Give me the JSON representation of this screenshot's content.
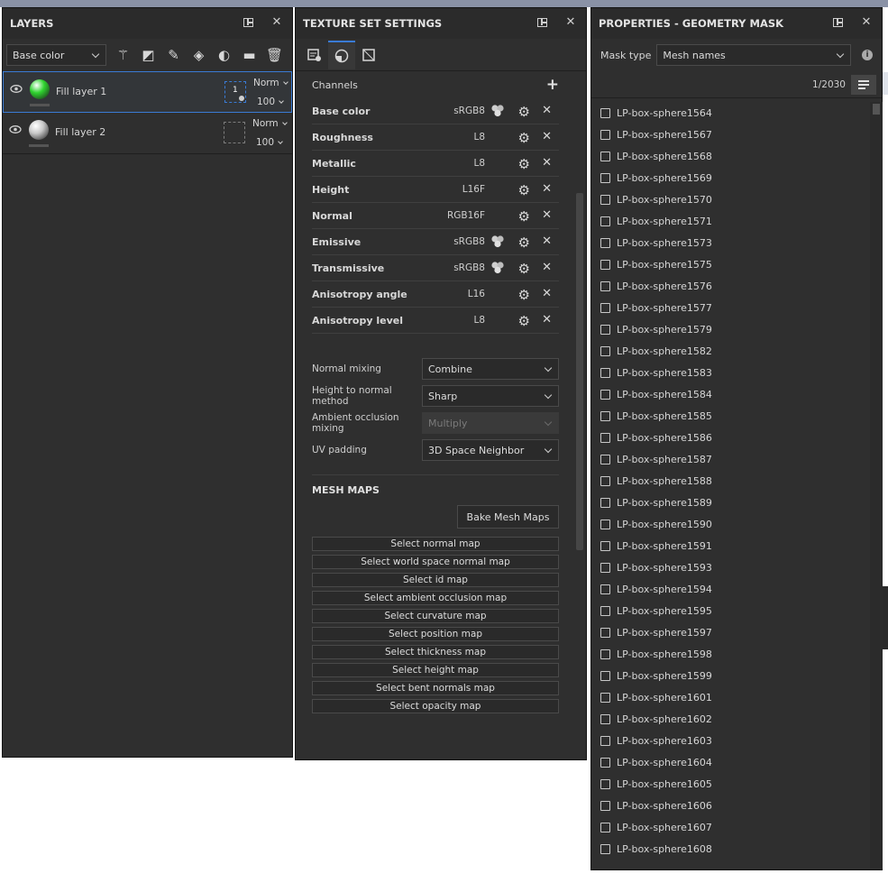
{
  "layers_panel": {
    "title": "LAYERS",
    "channel_select": "Base color",
    "tool_icons": [
      "magic-wand-icon",
      "add-layer-icon",
      "paint-layer-icon",
      "fill-layer-icon",
      "add-mask-icon",
      "folder-icon",
      "delete-icon"
    ],
    "layers": [
      {
        "name": "Fill layer 1",
        "blend": "Norm",
        "opacity": "100",
        "mask_label": "1",
        "selected": true,
        "ball_color": "#2fd42f"
      },
      {
        "name": "Fill layer 2",
        "blend": "Norm",
        "opacity": "100",
        "mask_label": "",
        "selected": false,
        "ball_color": "#c8c8c8"
      }
    ]
  },
  "texture_set_panel": {
    "title": "TEXTURE SET SETTINGS",
    "channels_label": "Channels",
    "channels": [
      {
        "name": "Base color",
        "format": "sRGB8",
        "multi": true
      },
      {
        "name": "Roughness",
        "format": "L8",
        "multi": false
      },
      {
        "name": "Metallic",
        "format": "L8",
        "multi": false
      },
      {
        "name": "Height",
        "format": "L16F",
        "multi": false
      },
      {
        "name": "Normal",
        "format": "RGB16F",
        "multi": false
      },
      {
        "name": "Emissive",
        "format": "sRGB8",
        "multi": true
      },
      {
        "name": "Transmissive",
        "format": "sRGB8",
        "multi": true
      },
      {
        "name": "Anisotropy angle",
        "format": "L16",
        "multi": false
      },
      {
        "name": "Anisotropy level",
        "format": "L8",
        "multi": false
      }
    ],
    "options": [
      {
        "label": "Normal mixing",
        "value": "Combine",
        "disabled": false
      },
      {
        "label": "Height to normal method",
        "value": "Sharp",
        "disabled": false
      },
      {
        "label": "Ambient occlusion mixing",
        "value": "Multiply",
        "disabled": true
      },
      {
        "label": "UV padding",
        "value": "3D Space Neighbor",
        "disabled": false
      }
    ],
    "mesh_maps_title": "MESH MAPS",
    "bake_label": "Bake Mesh Maps",
    "map_buttons": [
      "Select normal map",
      "Select world space normal map",
      "Select id map",
      "Select ambient occlusion map",
      "Select curvature map",
      "Select position map",
      "Select thickness map",
      "Select height map",
      "Select bent normals map",
      "Select opacity map"
    ]
  },
  "properties_panel": {
    "title": "PROPERTIES - GEOMETRY MASK",
    "mask_type_label": "Mask type",
    "mask_type_value": "Mesh names",
    "count": "1/2030",
    "meshes": [
      "LP-box-sphere1564",
      "LP-box-sphere1567",
      "LP-box-sphere1568",
      "LP-box-sphere1569",
      "LP-box-sphere1570",
      "LP-box-sphere1571",
      "LP-box-sphere1573",
      "LP-box-sphere1575",
      "LP-box-sphere1576",
      "LP-box-sphere1577",
      "LP-box-sphere1579",
      "LP-box-sphere1582",
      "LP-box-sphere1583",
      "LP-box-sphere1584",
      "LP-box-sphere1585",
      "LP-box-sphere1586",
      "LP-box-sphere1587",
      "LP-box-sphere1588",
      "LP-box-sphere1589",
      "LP-box-sphere1590",
      "LP-box-sphere1591",
      "LP-box-sphere1593",
      "LP-box-sphere1594",
      "LP-box-sphere1595",
      "LP-box-sphere1597",
      "LP-box-sphere1598",
      "LP-box-sphere1599",
      "LP-box-sphere1601",
      "LP-box-sphere1602",
      "LP-box-sphere1603",
      "LP-box-sphere1604",
      "LP-box-sphere1605",
      "LP-box-sphere1606",
      "LP-box-sphere1607",
      "LP-box-sphere1608"
    ]
  },
  "colors": {
    "accent": "#3a7bd5",
    "panel_bg": "#2f2f2f"
  }
}
